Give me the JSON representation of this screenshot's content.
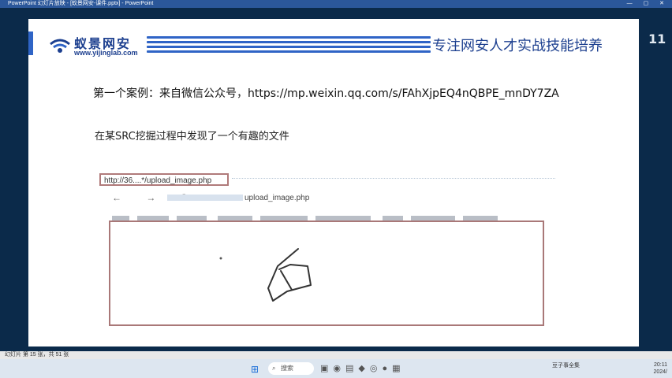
{
  "window": {
    "title": "PowerPoint 幻灯片放映 - [蚁景网安-课件.pptx] - PowerPoint",
    "controls": "— ▢ ✕"
  },
  "side_number": "11",
  "slide": {
    "brand": {
      "name": "蚁景网安",
      "url": "www.yijinglab.com"
    },
    "slogan": "专注网安人才实战技能培养",
    "case_title": "第一个案例：来自微信公众号，https://mp.weixin.qq.com/s/FAhXjpEQ4nQBPE_mnDY7ZA",
    "description": "在某SRC挖掘过程中发现了一个有趣的文件",
    "browser": {
      "url_callout": "http://36....*/upload_image.php",
      "nav": "← → C",
      "address_suffix": "upload_image.php"
    }
  },
  "statusbar": {
    "left": "幻灯片 第 15 张，共 51 张"
  },
  "taskbar": {
    "start_icon": "windows-icon",
    "search_placeholder": "搜索",
    "tray_label": "豆子事全集",
    "clock_time": "20:11",
    "clock_date": "2024/"
  },
  "colors": {
    "brand_blue": "#1c3f8f",
    "accent_blue": "#2f64c6",
    "callout_border": "#b07a7a"
  }
}
